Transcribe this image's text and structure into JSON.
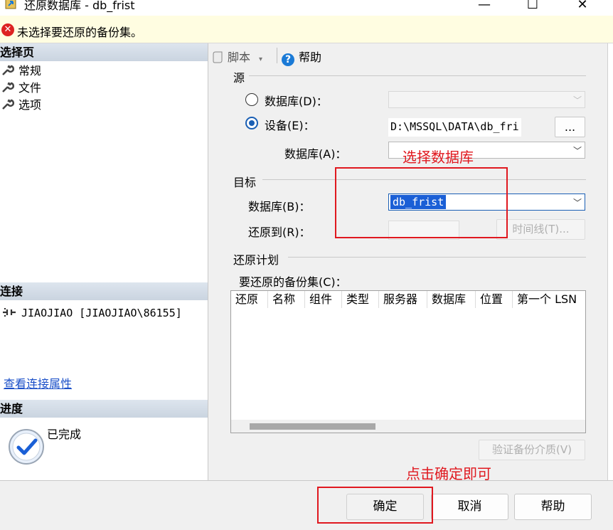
{
  "window": {
    "title": "还原数据库 - db_frist",
    "minimize": "—",
    "maximize": "☐",
    "close": "✕"
  },
  "banner": {
    "icon": "error-icon",
    "message": "未选择要还原的备份集。"
  },
  "left": {
    "select_page_header": "选择页",
    "pages": [
      "常规",
      "文件",
      "选项"
    ],
    "connection_header": "连接",
    "connection_text": "JIAOJIAO [JIAOJIAO\\86155]",
    "connection_link": "查看连接属性",
    "progress_header": "进度",
    "progress_status": "已完成"
  },
  "toolbar": {
    "script_label": "脚本",
    "help_label": "帮助"
  },
  "source": {
    "group_label": "源",
    "database_radio_label": "数据库(D)：",
    "database_value": "",
    "device_radio_label": "设备(E)：",
    "selected_option": "设备(E)",
    "device_value": "D:\\MSSQL\\DATA\\db_fri",
    "browse_label": "...",
    "device_db_label": "数据库(A)：",
    "device_db_value": ""
  },
  "target": {
    "group_label": "目标",
    "database_label": "数据库(B)：",
    "database_value": "db_frist",
    "restore_to_label": "还原到(R)：",
    "restore_to_value": "",
    "timeline_label": "时间线(T)..."
  },
  "plan": {
    "group_label": "还原计划",
    "backup_sets_label": "要还原的备份集(C)：",
    "columns": [
      "还原",
      "名称",
      "组件",
      "类型",
      "服务器",
      "数据库",
      "位置",
      "第一个 LSN"
    ],
    "verify_label": "验证备份介质(V)"
  },
  "buttons": {
    "ok": "确定",
    "cancel": "取消",
    "help": "帮助"
  },
  "annotations": {
    "select_db": "选择数据库",
    "click_ok": "点击确定即可",
    "color": "#e0181f"
  }
}
